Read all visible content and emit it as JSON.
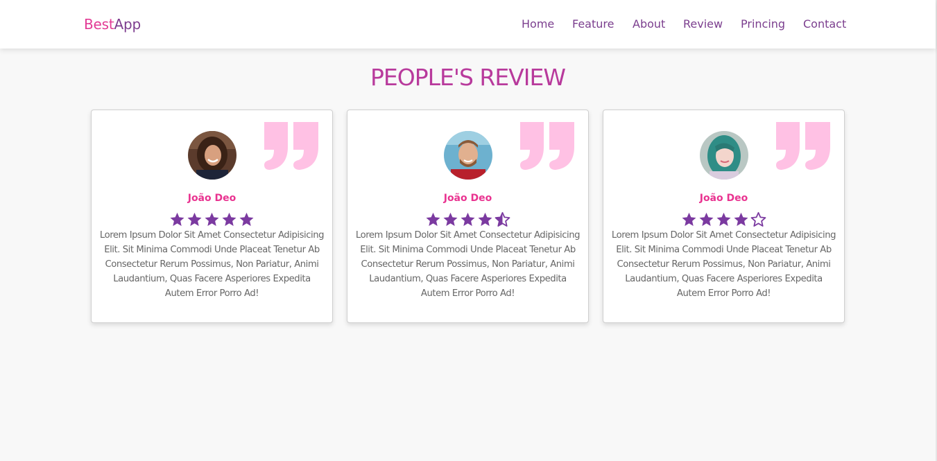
{
  "brand": {
    "part1": "Best",
    "part2": "App",
    "color_part1": "#e23b95",
    "color_part2": "#7d3d8f"
  },
  "nav": [
    {
      "label": "Home"
    },
    {
      "label": "Feature"
    },
    {
      "label": "About"
    },
    {
      "label": "Review"
    },
    {
      "label": "Princing"
    },
    {
      "label": "Contact"
    }
  ],
  "section": {
    "title": "PEOPLE'S REVIEW"
  },
  "colors": {
    "accent_purple": "#7b3e8e",
    "title_magenta": "#b83a9c",
    "name_pink": "#e93390",
    "star_purple": "#7b3aa0",
    "quote_pink": "#ffc1e4",
    "page_bg": "#f8f8f8"
  },
  "reviews": [
    {
      "avatar_icon": "woman-portrait-avatar",
      "quote_icon": "quote-icon",
      "name": "João Deo",
      "rating": 5,
      "text": "Lorem Ipsum Dolor Sit Amet Consectetur Adipisicing Elit. Sit Minima Commodi Unde Placeat Tenetur Ab Consectetur Rerum Possimus, Non Pariatur, Animi Laudantium, Quas Facere Asperiores Expedita Autem Error Porro Ad!"
    },
    {
      "avatar_icon": "man-portrait-avatar",
      "quote_icon": "quote-icon",
      "name": "João Deo",
      "rating": 4.5,
      "text": "Lorem Ipsum Dolor Sit Amet Consectetur Adipisicing Elit. Sit Minima Commodi Unde Placeat Tenetur Ab Consectetur Rerum Possimus, Non Pariatur, Animi Laudantium, Quas Facere Asperiores Expedita Autem Error Porro Ad!"
    },
    {
      "avatar_icon": "girl-portrait-avatar",
      "quote_icon": "quote-icon",
      "name": "João Deo",
      "rating": 4,
      "text": "Lorem Ipsum Dolor Sit Amet Consectetur Adipisicing Elit. Sit Minima Commodi Unde Placeat Tenetur Ab Consectetur Rerum Possimus, Non Pariatur, Animi Laudantium, Quas Facere Asperiores Expedita Autem Error Porro Ad!"
    }
  ]
}
